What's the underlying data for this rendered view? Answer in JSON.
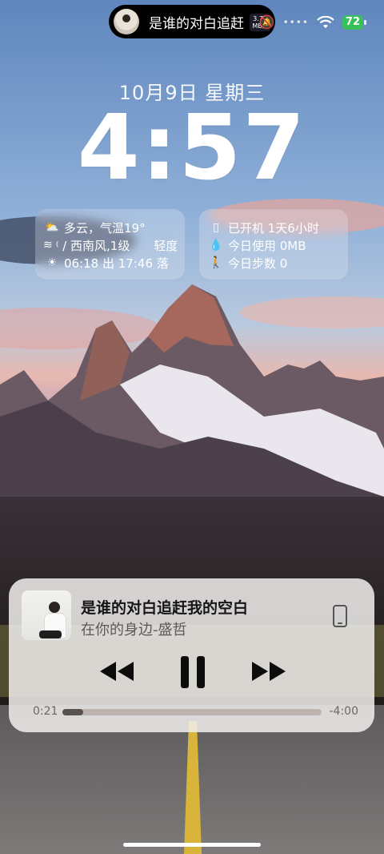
{
  "status_bar": {
    "song_snippet": "是谁的对白追赶",
    "net_speed_value": "3.75",
    "net_speed_unit": "MB/s",
    "signal_dots": "••••",
    "battery": "72",
    "colors": {
      "battery": "#36c15a"
    }
  },
  "lock": {
    "date": "10月9日 星期三",
    "time": "4:57"
  },
  "weather_widget": {
    "line1": "多云，气温19°",
    "line2": "⁽ / 西南风,1级　　轻度",
    "line3": "06:18 出 17:46 落",
    "icons": [
      "cloud-sun-icon",
      "wind-icon",
      "sunrise-icon"
    ]
  },
  "usage_widget": {
    "line1": "已开机 1天6小时",
    "line2": "今日使用 0MB",
    "line3": "今日步数 0",
    "icons": [
      "phone-icon",
      "drop-icon",
      "walk-icon"
    ]
  },
  "player": {
    "title": "是谁的对白追赶我的空白",
    "artist": "在你的身边-盛哲",
    "elapsed": "0:21",
    "remaining": "-4:00",
    "progress_fraction": 0.08,
    "controls": [
      "rewind-icon",
      "pause-icon",
      "fast-forward-icon"
    ]
  }
}
